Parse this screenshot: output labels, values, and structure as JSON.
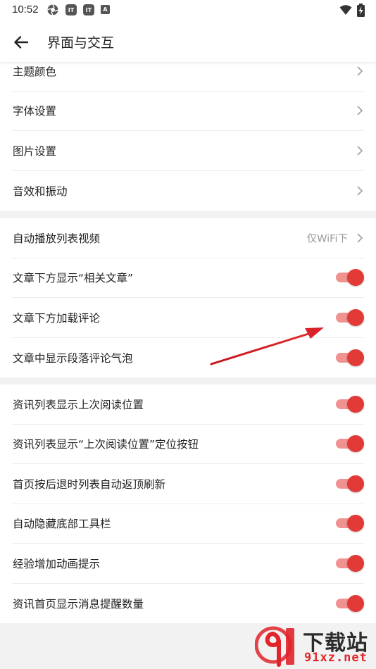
{
  "status_bar": {
    "time": "10:52",
    "icons": [
      "aperture-icon",
      "app-badge-icon",
      "app-badge-icon",
      "a-badge-icon"
    ],
    "badge_letters": [
      "IT",
      "IT",
      "A"
    ],
    "right_icons": [
      "wifi-icon",
      "battery-charging-icon"
    ]
  },
  "app_bar": {
    "title": "界面与交互",
    "back_icon": "arrow-left-icon"
  },
  "sections": [
    {
      "items": [
        {
          "label": "主题颜色",
          "control": "chevron"
        },
        {
          "label": "字体设置",
          "control": "chevron"
        },
        {
          "label": "图片设置",
          "control": "chevron"
        },
        {
          "label": "音效和振动",
          "control": "chevron"
        }
      ]
    },
    {
      "items": [
        {
          "label": "自动播放列表视频",
          "control": "chevron",
          "value": "仅WiFi下"
        },
        {
          "label": "文章下方显示“相关文章”",
          "control": "toggle",
          "on": true
        },
        {
          "label": "文章下方加载评论",
          "control": "toggle",
          "on": true
        },
        {
          "label": "文章中显示段落评论气泡",
          "control": "toggle",
          "on": true
        }
      ]
    },
    {
      "items": [
        {
          "label": "资讯列表显示上次阅读位置",
          "control": "toggle",
          "on": true
        },
        {
          "label": "资讯列表显示“上次阅读位置”定位按钮",
          "control": "toggle",
          "on": true
        },
        {
          "label": "首页按后退时列表自动返顶刷新",
          "control": "toggle",
          "on": true
        },
        {
          "label": "自动隐藏底部工具栏",
          "control": "toggle",
          "on": true
        },
        {
          "label": "经验增加动画提示",
          "control": "toggle",
          "on": true
        },
        {
          "label": "资讯首页显示消息提醒数量",
          "control": "toggle",
          "on": true
        }
      ]
    }
  ],
  "colors": {
    "accent": "#e23a36",
    "track": "#f0928f",
    "annotation_arrow": "#d9222a"
  },
  "watermark": {
    "logo_text": "9",
    "title": "下载站",
    "url": "91xz.net"
  }
}
